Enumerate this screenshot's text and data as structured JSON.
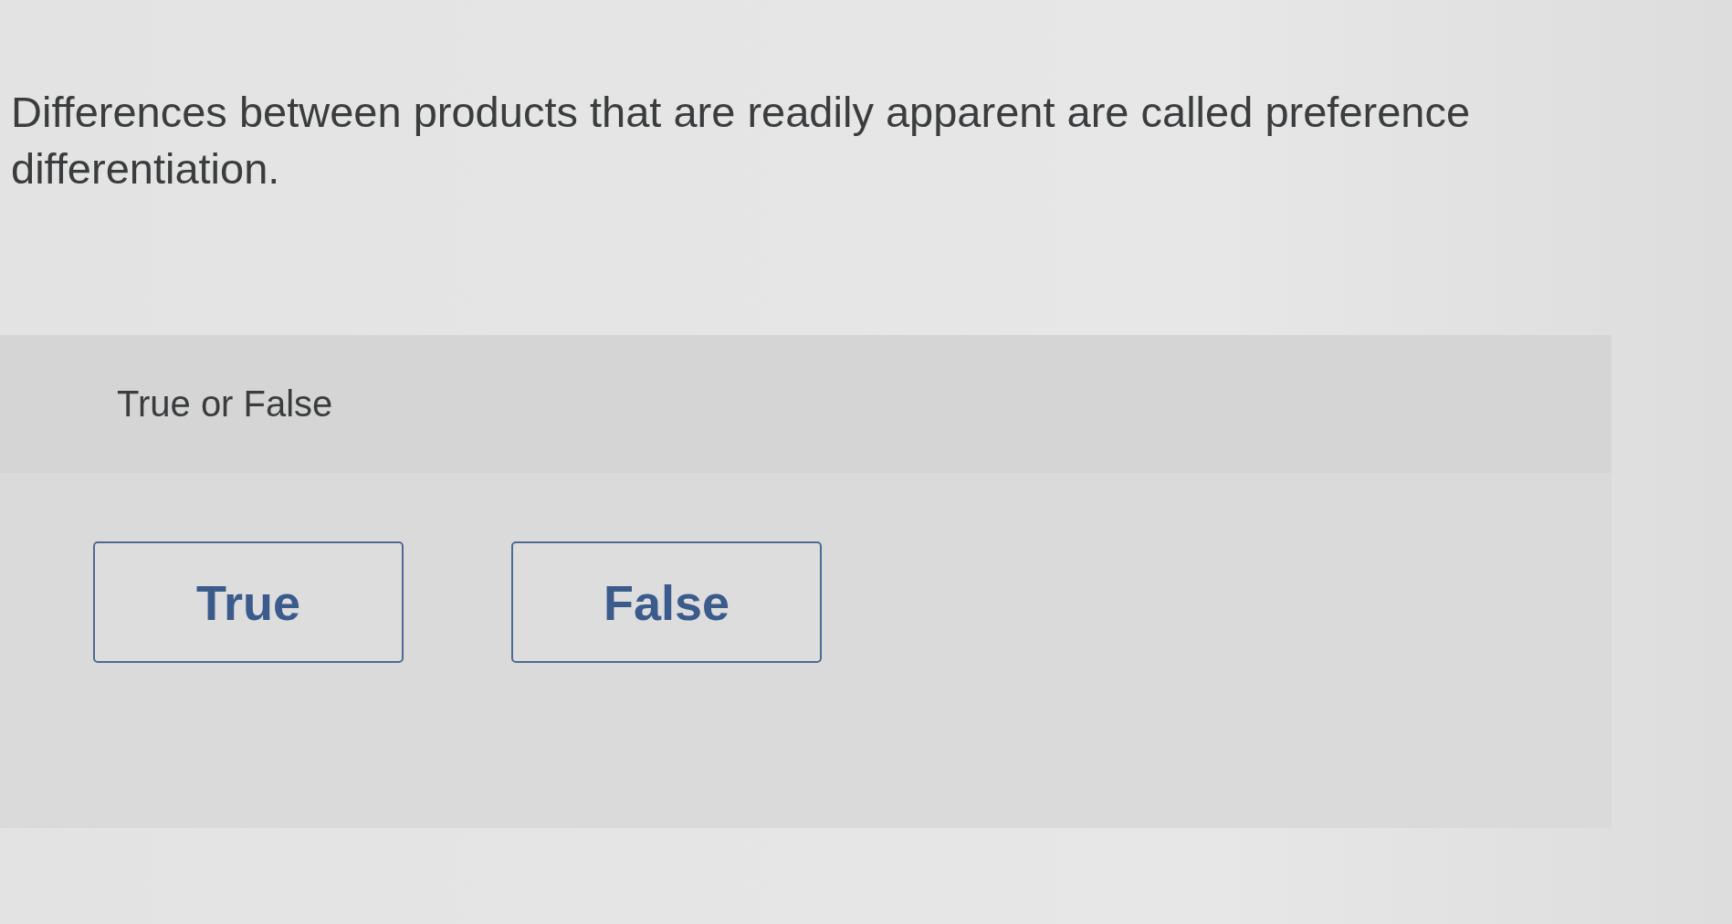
{
  "question": {
    "text": "Differences between products that are readily apparent are called preference differentiation."
  },
  "answer_panel": {
    "prompt": "True or False",
    "options": [
      {
        "label": "True"
      },
      {
        "label": "False"
      }
    ]
  }
}
